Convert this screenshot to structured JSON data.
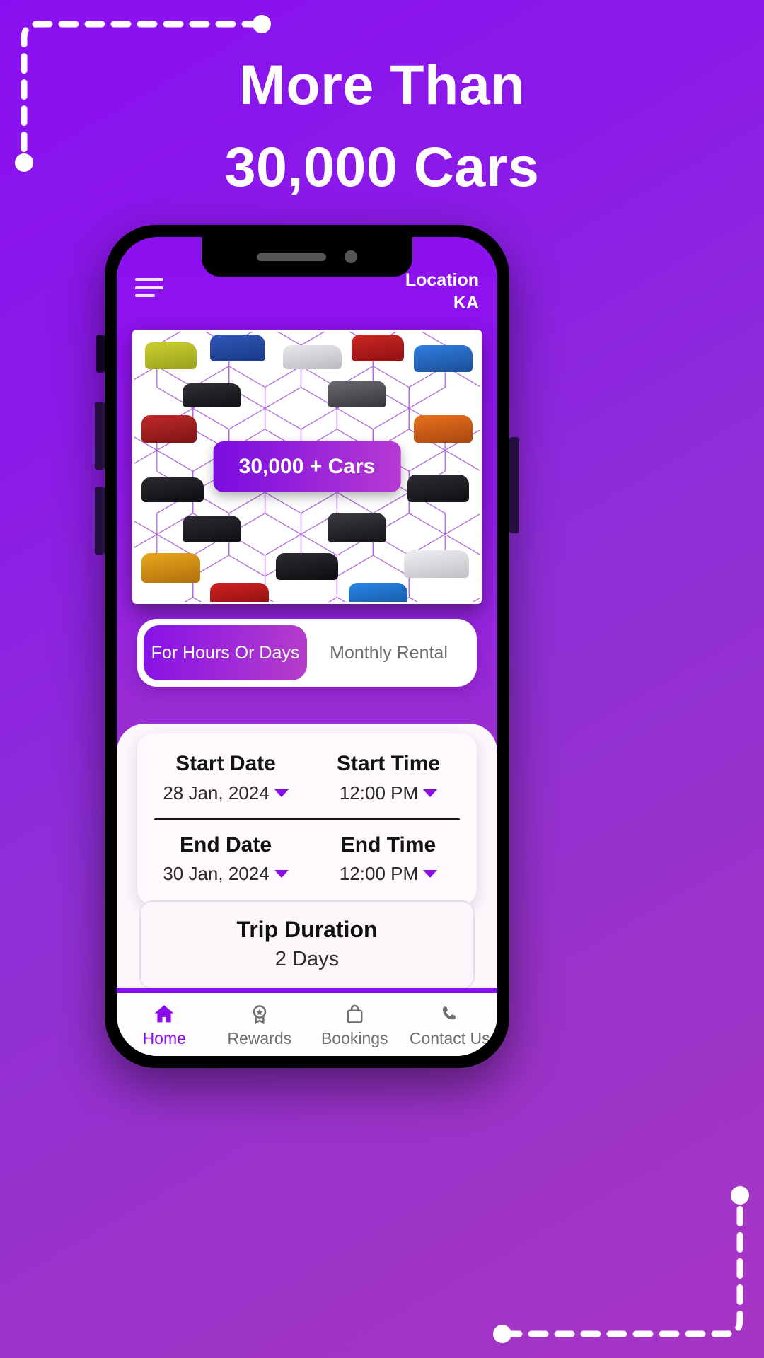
{
  "promo": {
    "headline_line1": "More Than",
    "headline_line2": "30,000 Cars"
  },
  "colors": {
    "brand_purple": "#8a0ff0",
    "accent_magenta": "#b83ec8",
    "sheet_bg": "#fbf7fb"
  },
  "app": {
    "header": {
      "menu_icon": "hamburger-icon",
      "location_label": "Location",
      "location_value": "KA"
    },
    "hero": {
      "badge_text": "30,000 + Cars"
    },
    "rental_type_toggle": {
      "options": [
        {
          "label": "For Hours Or Days",
          "active": true
        },
        {
          "label": "Monthly Rental",
          "active": false
        }
      ]
    },
    "booking_form": {
      "start_date": {
        "label": "Start Date",
        "value": "28 Jan, 2024"
      },
      "start_time": {
        "label": "Start Time",
        "value": "12:00 PM"
      },
      "end_date": {
        "label": "End Date",
        "value": "30 Jan, 2024"
      },
      "end_time": {
        "label": "End Time",
        "value": "12:00 PM"
      }
    },
    "trip_duration": {
      "title": "Trip Duration",
      "value": "2 Days"
    },
    "bottom_nav": {
      "items": [
        {
          "label": "Home",
          "icon": "home-icon",
          "active": true
        },
        {
          "label": "Rewards",
          "icon": "badge-icon",
          "active": false
        },
        {
          "label": "Bookings",
          "icon": "bag-icon",
          "active": false
        },
        {
          "label": "Contact Us",
          "icon": "phone-icon",
          "active": false
        }
      ]
    }
  }
}
